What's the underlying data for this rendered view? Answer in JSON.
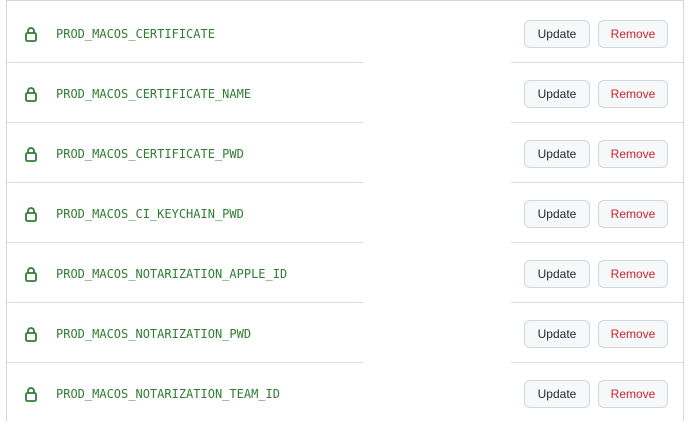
{
  "buttons": {
    "update_label": "Update",
    "remove_label": "Remove"
  },
  "icons": {
    "secret": "lock-icon"
  },
  "colors": {
    "secret_name": "#2e7d32",
    "remove_text": "#cf222e",
    "lock_icon": "#2e7d32"
  },
  "secrets": [
    {
      "name": "PROD_MACOS_CERTIFICATE"
    },
    {
      "name": "PROD_MACOS_CERTIFICATE_NAME"
    },
    {
      "name": "PROD_MACOS_CERTIFICATE_PWD"
    },
    {
      "name": "PROD_MACOS_CI_KEYCHAIN_PWD"
    },
    {
      "name": "PROD_MACOS_NOTARIZATION_APPLE_ID"
    },
    {
      "name": "PROD_MACOS_NOTARIZATION_PWD"
    },
    {
      "name": "PROD_MACOS_NOTARIZATION_TEAM_ID"
    }
  ]
}
